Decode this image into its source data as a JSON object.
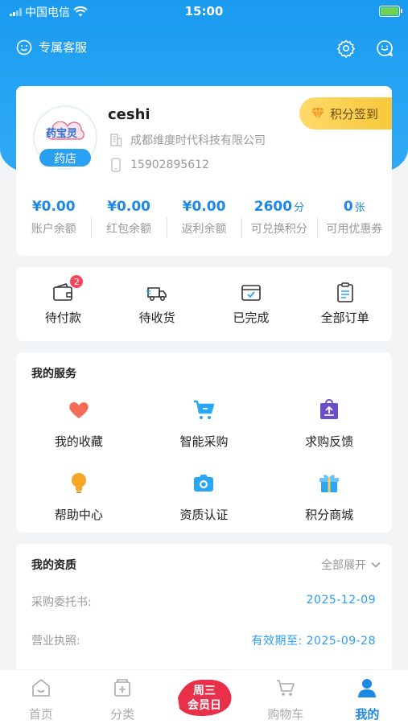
{
  "status_bar": {
    "carrier": "中国电信",
    "time": "15:00"
  },
  "header": {
    "customer_service": "专属客服"
  },
  "profile": {
    "username": "ceshi",
    "company": "成都维度时代科技有限公司",
    "phone": "15902895612",
    "store_tag": "药店",
    "logo_text": "药宝灵",
    "sign_in": "积分签到"
  },
  "stats": [
    {
      "value": "¥0.00",
      "unit": "",
      "label": "账户余额"
    },
    {
      "value": "¥0.00",
      "unit": "",
      "label": "红包余额"
    },
    {
      "value": "¥0.00",
      "unit": "",
      "label": "返利余额"
    },
    {
      "value": "2600",
      "unit": "分",
      "label": "可兑换积分"
    },
    {
      "value": "0",
      "unit": "张",
      "label": "可用优惠券"
    }
  ],
  "orders": [
    {
      "label": "待付款",
      "badge": "2"
    },
    {
      "label": "待收货"
    },
    {
      "label": "已完成"
    },
    {
      "label": "全部订单"
    }
  ],
  "services": {
    "title": "我的服务",
    "items": [
      {
        "label": "我的收藏",
        "icon": "heart-icon"
      },
      {
        "label": "智能采购",
        "icon": "cart-icon"
      },
      {
        "label": "求购反馈",
        "icon": "feedback-bag-icon"
      },
      {
        "label": "帮助中心",
        "icon": "lightbulb-icon"
      },
      {
        "label": "资质认证",
        "icon": "camera-icon"
      },
      {
        "label": "积分商城",
        "icon": "gift-icon"
      }
    ]
  },
  "qualifications": {
    "title": "我的资质",
    "expand": "全部展开",
    "rows": [
      {
        "label": "采购委托书:",
        "value": "2025-12-09"
      },
      {
        "label": "营业执照:",
        "value": "有效期至: 2025-09-28"
      }
    ]
  },
  "tabbar": {
    "items": [
      {
        "label": "首页"
      },
      {
        "label": "分类"
      },
      {
        "label": ""
      },
      {
        "label": "购物车"
      },
      {
        "label": "我的"
      }
    ],
    "promo_text": [
      "周三",
      "会员日"
    ]
  },
  "colors": {
    "primary": "#2aa6f4",
    "accent_blue": "#1e88e5",
    "gold": "#f7c83b",
    "badge_red": "#f5455c",
    "promo_red": "#e8304a"
  }
}
